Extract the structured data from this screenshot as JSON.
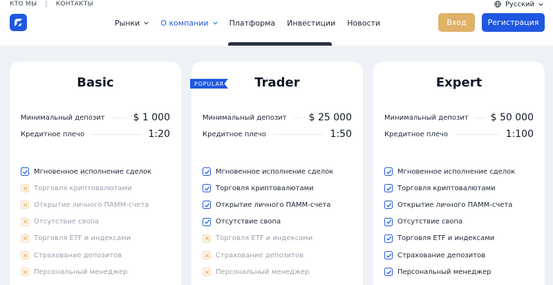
{
  "topbar": {
    "about": "КТО МЫ",
    "separator": "|",
    "contacts": "КОНТАКТЫ"
  },
  "language": {
    "label": "Русский"
  },
  "nav": [
    {
      "label": "Рынки",
      "dropdown": true,
      "active": false
    },
    {
      "label": "О компании",
      "dropdown": true,
      "active": true
    },
    {
      "label": "Платформа",
      "dropdown": false,
      "active": false
    },
    {
      "label": "Инвестиции",
      "dropdown": false,
      "active": false
    },
    {
      "label": "Новости",
      "dropdown": false,
      "active": false
    }
  ],
  "buttons": {
    "login": "Вход",
    "register": "Регистрация"
  },
  "colors": {
    "brand": "#1f57e0",
    "login": "#dfb268",
    "check": "#1f57e0",
    "cross": "#e8a860"
  },
  "features": [
    "Мгновенное исполнение сделок",
    "Торговля криптовалютами",
    "Открытие личного ПАММ-счета",
    "Отсутствие свопа",
    "Торговля ETF и индексами",
    "Страхование депозитов",
    "Персональный менеджер"
  ],
  "plans": [
    {
      "name": "Basic",
      "badge": "",
      "min_deposit_label": "Минимальный депозит",
      "min_deposit": "$ 1 000",
      "leverage_label": "Кредитное плечо",
      "leverage": "1:20",
      "included": [
        true,
        false,
        false,
        false,
        false,
        false,
        false
      ]
    },
    {
      "name": "Trader",
      "badge": "POPULAR",
      "min_deposit_label": "Минимальный депозит",
      "min_deposit": "$ 25 000",
      "leverage_label": "Кредитное плечо",
      "leverage": "1:50",
      "included": [
        true,
        true,
        true,
        true,
        false,
        false,
        false
      ]
    },
    {
      "name": "Expert",
      "badge": "",
      "min_deposit_label": "Минимальный депозит",
      "min_deposit": "$ 50 000",
      "leverage_label": "Кредитное плечо",
      "leverage": "1:100",
      "included": [
        true,
        true,
        true,
        true,
        true,
        true,
        true
      ]
    }
  ]
}
